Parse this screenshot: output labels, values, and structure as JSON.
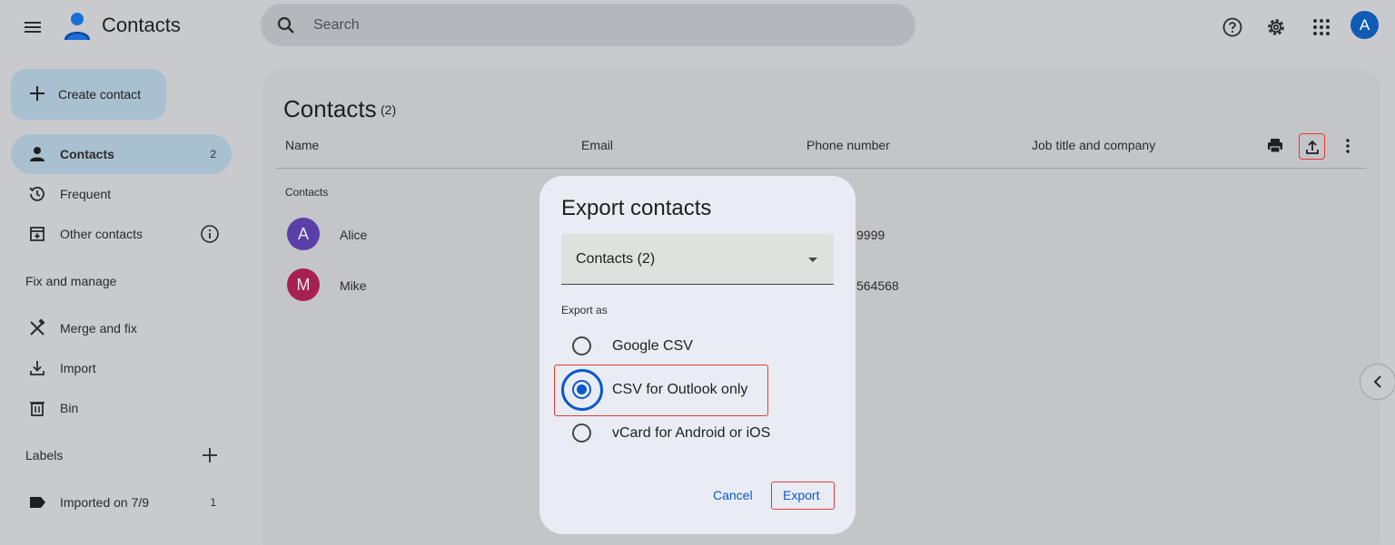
{
  "app": {
    "title": "Contacts"
  },
  "search": {
    "placeholder": "Search"
  },
  "user": {
    "avatar_letter": "A"
  },
  "sidebar": {
    "create_label": "Create contact",
    "items": [
      {
        "label": "Contacts",
        "count": "2",
        "icon": "person-icon",
        "active": true
      },
      {
        "label": "Frequent",
        "icon": "history-icon"
      },
      {
        "label": "Other contacts",
        "icon": "archive-icon"
      }
    ],
    "fix_heading": "Fix and manage",
    "fix_items": [
      {
        "label": "Merge and fix",
        "icon": "tools-icon"
      },
      {
        "label": "Import",
        "icon": "download-icon"
      },
      {
        "label": "Bin",
        "icon": "trash-icon"
      }
    ],
    "labels_heading": "Labels",
    "labels": [
      {
        "label": "Imported on 7/9",
        "count": "1",
        "icon": "label-icon"
      }
    ]
  },
  "main": {
    "title": "Contacts",
    "count": "(2)",
    "columns": [
      "Name",
      "Email",
      "Phone number",
      "Job title and company"
    ],
    "group_label": "Contacts",
    "rows": [
      {
        "initial": "A",
        "name": "Alice",
        "phone_visible": "9999",
        "avatar_color": "#5b3fa8"
      },
      {
        "initial": "M",
        "name": "Mike",
        "phone_visible": "564568",
        "avatar_color": "#a8204f"
      }
    ]
  },
  "dialog": {
    "title": "Export contacts",
    "selected_source": "Contacts (2)",
    "export_as_label": "Export as",
    "options": [
      {
        "label": "Google CSV",
        "checked": false
      },
      {
        "label": "CSV for Outlook only",
        "checked": true
      },
      {
        "label": "vCard for Android or iOS",
        "checked": false
      }
    ],
    "cancel_label": "Cancel",
    "export_label": "Export"
  },
  "colors": {
    "accent": "#0b57d0",
    "highlight": "#e53935"
  }
}
